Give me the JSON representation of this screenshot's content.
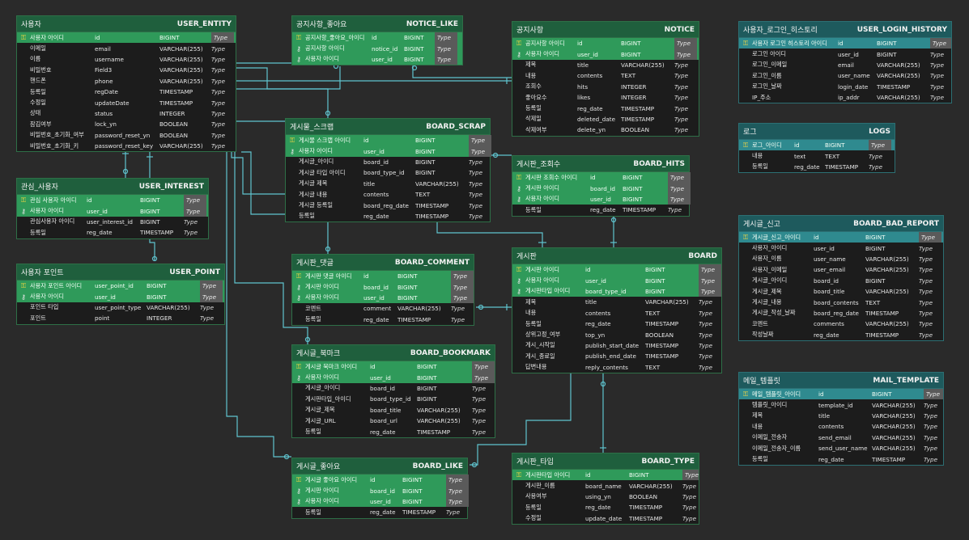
{
  "colors": {
    "background": "#2a2a2a",
    "header_green": "#1f5f3d",
    "header_teal": "#1e5a5d",
    "key_row_green": "#2f9a5a",
    "key_row_teal": "#2f8a8f",
    "connector": "#5fc4cf"
  },
  "entities": [
    {
      "id": "user_entity",
      "theme": "green",
      "name_ko": "사용자",
      "name_en": "USER_ENTITY",
      "rows": [
        {
          "k": "pk",
          "ko": "사용자 아이디",
          "col": "id",
          "type": "BIGINT",
          "ty": "Type"
        },
        {
          "k": "",
          "ko": "이메일",
          "col": "email",
          "type": "VARCHAR(255)",
          "ty": "Type"
        },
        {
          "k": "",
          "ko": "이름",
          "col": "username",
          "type": "VARCHAR(255)",
          "ty": "Type"
        },
        {
          "k": "",
          "ko": "비밀번호",
          "col": "Field3",
          "type": "VARCHAR(255)",
          "ty": "Type"
        },
        {
          "k": "",
          "ko": "핸드폰",
          "col": "phone",
          "type": "VARCHAR(255)",
          "ty": "Type"
        },
        {
          "k": "",
          "ko": "등록일",
          "col": "regDate",
          "type": "TIMESTAMP",
          "ty": "Type"
        },
        {
          "k": "",
          "ko": "수정일",
          "col": "updateDate",
          "type": "TIMESTAMP",
          "ty": "Type"
        },
        {
          "k": "",
          "ko": "상태",
          "col": "status",
          "type": "INTEGER",
          "ty": "Type"
        },
        {
          "k": "",
          "ko": "잠김여부",
          "col": "lock_yn",
          "type": "BOOLEAN",
          "ty": "Type"
        },
        {
          "k": "",
          "ko": "비밀번호_초기화_여부",
          "col": "password_reset_yn",
          "type": "BOOLEAN",
          "ty": "Type"
        },
        {
          "k": "",
          "ko": "비밀번호_초기화_키",
          "col": "password_reset_key",
          "type": "VARCHAR(255)",
          "ty": "Type"
        }
      ]
    },
    {
      "id": "user_interest",
      "theme": "green",
      "name_ko": "관심_사용자",
      "name_en": "USER_INTEREST",
      "rows": [
        {
          "k": "pk",
          "ko": "관심 사용자 아이디",
          "col": "id",
          "type": "BIGINT",
          "ty": "Type"
        },
        {
          "k": "fk",
          "ko": "사용자 아이디",
          "col": "user_id",
          "type": "BIGINT",
          "ty": "Type"
        },
        {
          "k": "",
          "ko": "관심사용자 아이디",
          "col": "user_interest_id",
          "type": "BIGINT",
          "ty": "Type"
        },
        {
          "k": "",
          "ko": "등록일",
          "col": "reg_date",
          "type": "TIMESTAMP",
          "ty": "Type"
        }
      ]
    },
    {
      "id": "user_point",
      "theme": "green",
      "name_ko": "사용자 포인트",
      "name_en": "USER_POINT",
      "rows": [
        {
          "k": "pk",
          "ko": "사용자 포인트 아이디",
          "col": "user_point_id",
          "type": "BIGINT",
          "ty": "Type"
        },
        {
          "k": "fk",
          "ko": "사용자 아이디",
          "col": "user_id",
          "type": "BIGINT",
          "ty": "Type"
        },
        {
          "k": "",
          "ko": "포인트 타입",
          "col": "user_point_type",
          "type": "VARCHAR(255)",
          "ty": "Type"
        },
        {
          "k": "",
          "ko": "포인트",
          "col": "point",
          "type": "INTEGER",
          "ty": "Type"
        }
      ]
    },
    {
      "id": "notice_like",
      "theme": "green",
      "name_ko": "공지사항_좋아요",
      "name_en": "NOTICE_LIKE",
      "rows": [
        {
          "k": "pk",
          "ko": "공지사항_좋아요_아이디",
          "col": "id",
          "type": "BIGINT",
          "ty": "Type"
        },
        {
          "k": "fk",
          "ko": "공지사항 아이디",
          "col": "notice_id",
          "type": "BIGINT",
          "ty": "Type"
        },
        {
          "k": "fk",
          "ko": "사용자 아이디",
          "col": "user_id",
          "type": "BIGINT",
          "ty": "Type"
        }
      ]
    },
    {
      "id": "board_scrap",
      "theme": "green",
      "name_ko": "게시물_스크랩",
      "name_en": "BOARD_SCRAP",
      "rows": [
        {
          "k": "pk",
          "ko": "게시물 스크랩 아이디",
          "col": "id",
          "type": "BIGINT",
          "ty": "Type"
        },
        {
          "k": "fk",
          "ko": "사용자 아이디",
          "col": "user_id",
          "type": "BIGINT",
          "ty": "Type"
        },
        {
          "k": "",
          "ko": "게시글_아이디",
          "col": "board_id",
          "type": "BIGINT",
          "ty": "Type"
        },
        {
          "k": "",
          "ko": "게시글 타입 아이디",
          "col": "board_type_id",
          "type": "BIGINT",
          "ty": "Type"
        },
        {
          "k": "",
          "ko": "게시글 제목",
          "col": "title",
          "type": "VARCHAR(255)",
          "ty": "Type"
        },
        {
          "k": "",
          "ko": "게시글 내용",
          "col": "contents",
          "type": "TEXT",
          "ty": "Type"
        },
        {
          "k": "",
          "ko": "게시글 등록일",
          "col": "board_reg_date",
          "type": "TIMESTAMP",
          "ty": "Type"
        },
        {
          "k": "",
          "ko": "등록일",
          "col": "reg_date",
          "type": "TIMESTAMP",
          "ty": "Type"
        }
      ]
    },
    {
      "id": "board_comment",
      "theme": "green",
      "name_ko": "게시판_댓글",
      "name_en": "BOARD_COMMENT",
      "rows": [
        {
          "k": "pk",
          "ko": "게시판 댓글 아이디",
          "col": "id",
          "type": "BIGINT",
          "ty": "Type"
        },
        {
          "k": "fk",
          "ko": "게시판 아이디",
          "col": "board_id",
          "type": "BIGINT",
          "ty": "Type"
        },
        {
          "k": "fk",
          "ko": "사용자 아이디",
          "col": "user_id",
          "type": "BIGINT",
          "ty": "Type"
        },
        {
          "k": "",
          "ko": "코멘트",
          "col": "comment",
          "type": "VARCHAR(255)",
          "ty": "Type"
        },
        {
          "k": "",
          "ko": "등록일",
          "col": "reg_date",
          "type": "TIMESTAMP",
          "ty": "Type"
        }
      ]
    },
    {
      "id": "board_bookmark",
      "theme": "green",
      "name_ko": "게시글_북마크",
      "name_en": "BOARD_BOOKMARK",
      "rows": [
        {
          "k": "pk",
          "ko": "게시글 북마크 아이디",
          "col": "id",
          "type": "BIGINT",
          "ty": "Type"
        },
        {
          "k": "fk",
          "ko": "사용자 아이디",
          "col": "user_id",
          "type": "BIGINT",
          "ty": "Type"
        },
        {
          "k": "",
          "ko": "게시글_아이디",
          "col": "board_id",
          "type": "BIGINT",
          "ty": "Type"
        },
        {
          "k": "",
          "ko": "게시판타입_아이디",
          "col": "board_type_id",
          "type": "BIGINT",
          "ty": "Type"
        },
        {
          "k": "",
          "ko": "게시글_제목",
          "col": "board_title",
          "type": "VARCHAR(255)",
          "ty": "Type"
        },
        {
          "k": "",
          "ko": "게시글_URL",
          "col": "board_url",
          "type": "VARCHAR(255)",
          "ty": "Type"
        },
        {
          "k": "",
          "ko": "등록일",
          "col": "reg_date",
          "type": "TIMESTAMP",
          "ty": "Type"
        }
      ]
    },
    {
      "id": "board_like",
      "theme": "green",
      "name_ko": "게시글_좋아요",
      "name_en": "BOARD_LIKE",
      "rows": [
        {
          "k": "pk",
          "ko": "게시글 좋아요 아이디",
          "col": "id",
          "type": "BIGINT",
          "ty": "Type"
        },
        {
          "k": "fk",
          "ko": "게시판 아이디",
          "col": "board_id",
          "type": "BIGINT",
          "ty": "Type"
        },
        {
          "k": "fk",
          "ko": "사용자 아이디",
          "col": "user_id",
          "type": "BIGINT",
          "ty": "Type"
        },
        {
          "k": "",
          "ko": "등록일",
          "col": "reg_date",
          "type": "TIMESTAMP",
          "ty": "Type"
        }
      ]
    },
    {
      "id": "notice",
      "theme": "green",
      "name_ko": "공지사항",
      "name_en": "NOTICE",
      "rows": [
        {
          "k": "pk",
          "ko": "공지사항 아이디",
          "col": "id",
          "type": "BIGINT",
          "ty": "Type"
        },
        {
          "k": "fk",
          "ko": "사용자 아이디",
          "col": "user_id",
          "type": "BIGINT",
          "ty": "Type"
        },
        {
          "k": "",
          "ko": "제목",
          "col": "title",
          "type": "VARCHAR(255)",
          "ty": "Type"
        },
        {
          "k": "",
          "ko": "내용",
          "col": "contents",
          "type": "TEXT",
          "ty": "Type"
        },
        {
          "k": "",
          "ko": "조회수",
          "col": "hits",
          "type": "INTEGER",
          "ty": "Type"
        },
        {
          "k": "",
          "ko": "좋아요수",
          "col": "likes",
          "type": "INTEGER",
          "ty": "Type"
        },
        {
          "k": "",
          "ko": "등록일",
          "col": "reg_date",
          "type": "TIMESTAMP",
          "ty": "Type"
        },
        {
          "k": "",
          "ko": "삭제일",
          "col": "deleted_date",
          "type": "TIMESTAMP",
          "ty": "Type"
        },
        {
          "k": "",
          "ko": "삭제여부",
          "col": "delete_yn",
          "type": "BOOLEAN",
          "ty": "Type"
        }
      ]
    },
    {
      "id": "board_hits",
      "theme": "green",
      "name_ko": "게시판_조회수",
      "name_en": "BOARD_HITS",
      "rows": [
        {
          "k": "pk",
          "ko": "게시판 조회수 아이디",
          "col": "id",
          "type": "BIGINT",
          "ty": "Type"
        },
        {
          "k": "fk",
          "ko": "게시판 아이디",
          "col": "board_id",
          "type": "BIGINT",
          "ty": "Type"
        },
        {
          "k": "fk",
          "ko": "사용자 아이디",
          "col": "user_id",
          "type": "BIGINT",
          "ty": "Type"
        },
        {
          "k": "",
          "ko": "등록일",
          "col": "reg_date",
          "type": "TIMESTAMP",
          "ty": "Type"
        }
      ]
    },
    {
      "id": "board",
      "theme": "green",
      "name_ko": "게시판",
      "name_en": "BOARD",
      "rows": [
        {
          "k": "pk",
          "ko": "게시판 아이디",
          "col": "id",
          "type": "BIGINT",
          "ty": "Type"
        },
        {
          "k": "fk",
          "ko": "사용자 아이디",
          "col": "user_id",
          "type": "BIGINT",
          "ty": "Type"
        },
        {
          "k": "fk",
          "ko": "게시판타입 아이디",
          "col": "board_type_id",
          "type": "BIGINT",
          "ty": "Type"
        },
        {
          "k": "",
          "ko": "제목",
          "col": "title",
          "type": "VARCHAR(255)",
          "ty": "Type"
        },
        {
          "k": "",
          "ko": "내용",
          "col": "contents",
          "type": "TEXT",
          "ty": "Type"
        },
        {
          "k": "",
          "ko": "등록일",
          "col": "reg_date",
          "type": "TIMESTAMP",
          "ty": "Type"
        },
        {
          "k": "",
          "ko": "상위고정_여부",
          "col": "top_yn",
          "type": "BOOLEAN",
          "ty": "Type"
        },
        {
          "k": "",
          "ko": "게시_시작일",
          "col": "publish_start_date",
          "type": "TIMESTAMP",
          "ty": "Type"
        },
        {
          "k": "",
          "ko": "게시_종료일",
          "col": "publish_end_date",
          "type": "TIMESTAMP",
          "ty": "Type"
        },
        {
          "k": "",
          "ko": "답변내용",
          "col": "reply_contents",
          "type": "TEXT",
          "ty": "Type"
        }
      ]
    },
    {
      "id": "board_type",
      "theme": "green",
      "name_ko": "게시판_타입",
      "name_en": "BOARD_TYPE",
      "rows": [
        {
          "k": "pk",
          "ko": "게시판타입 아이디",
          "col": "id",
          "type": "BIGINT",
          "ty": "Type"
        },
        {
          "k": "",
          "ko": "게시판_이름",
          "col": "board_name",
          "type": "VARCHAR(255)",
          "ty": "Type"
        },
        {
          "k": "",
          "ko": "사용여부",
          "col": "using_yn",
          "type": "BOOLEAN",
          "ty": "Type"
        },
        {
          "k": "",
          "ko": "등록일",
          "col": "reg_date",
          "type": "TIMESTAMP",
          "ty": "Type"
        },
        {
          "k": "",
          "ko": "수정일",
          "col": "update_date",
          "type": "TIMESTAMP",
          "ty": "Type"
        }
      ]
    },
    {
      "id": "user_login_history",
      "theme": "blue",
      "name_ko": "사용자_로그인_히스토리",
      "name_en": "USER_LOGIN_HISTORY",
      "rows": [
        {
          "k": "pk",
          "ko": "사용자 로그인 히스토리 아이디",
          "col": "id",
          "type": "BIGINT",
          "ty": "Type"
        },
        {
          "k": "",
          "ko": "로그인 아이디",
          "col": "user_id",
          "type": "BIGINT",
          "ty": "Type"
        },
        {
          "k": "",
          "ko": "로그인_이메일",
          "col": "email",
          "type": "VARCHAR(255)",
          "ty": "Type"
        },
        {
          "k": "",
          "ko": "로그인_이름",
          "col": "user_name",
          "type": "VARCHAR(255)",
          "ty": "Type"
        },
        {
          "k": "",
          "ko": "로그인_날짜",
          "col": "login_date",
          "type": "TIMESTAMP",
          "ty": "Type"
        },
        {
          "k": "",
          "ko": "IP_주소",
          "col": "ip_addr",
          "type": "VARCHAR(255)",
          "ty": "Type"
        }
      ]
    },
    {
      "id": "logs",
      "theme": "blue",
      "name_ko": "로그",
      "name_en": "LOGS",
      "rows": [
        {
          "k": "pk",
          "ko": "로그_아이디",
          "col": "id",
          "type": "BIGINT",
          "ty": "Type"
        },
        {
          "k": "",
          "ko": "내용",
          "col": "text",
          "type": "TEXT",
          "ty": "Type"
        },
        {
          "k": "",
          "ko": "등록일",
          "col": "reg_date",
          "type": "TIMESTAMP",
          "ty": "Type"
        }
      ]
    },
    {
      "id": "board_bad_report",
      "theme": "blue",
      "name_ko": "게시글_신고",
      "name_en": "BOARD_BAD_REPORT",
      "rows": [
        {
          "k": "pk",
          "ko": "게시글_신고_아이디",
          "col": "id",
          "type": "BIGINT",
          "ty": "Type"
        },
        {
          "k": "",
          "ko": "사용자_아이디",
          "col": "user_id",
          "type": "BIGINT",
          "ty": "Type"
        },
        {
          "k": "",
          "ko": "사용자_이름",
          "col": "user_name",
          "type": "VARCHAR(255)",
          "ty": "Type"
        },
        {
          "k": "",
          "ko": "사용자_이메일",
          "col": "user_email",
          "type": "VARCHAR(255)",
          "ty": "Type"
        },
        {
          "k": "",
          "ko": "게시글_아이디",
          "col": "board_id",
          "type": "BIGINT",
          "ty": "Type"
        },
        {
          "k": "",
          "ko": "게시글_제목",
          "col": "board_title",
          "type": "VARCHAR(255)",
          "ty": "Type"
        },
        {
          "k": "",
          "ko": "게시글_내용",
          "col": "board_contents",
          "type": "TEXT",
          "ty": "Type"
        },
        {
          "k": "",
          "ko": "게시글_작성_날짜",
          "col": "board_reg_date",
          "type": "TIMESTAMP",
          "ty": "Type"
        },
        {
          "k": "",
          "ko": "코멘트",
          "col": "comments",
          "type": "VARCHAR(255)",
          "ty": "Type"
        },
        {
          "k": "",
          "ko": "작성날짜",
          "col": "reg_date",
          "type": "TIMESTAMP",
          "ty": "Type"
        }
      ]
    },
    {
      "id": "mail_template",
      "theme": "blue",
      "name_ko": "메일_템플릿",
      "name_en": "MAIL_TEMPLATE",
      "rows": [
        {
          "k": "pk",
          "ko": "메일_템플릿_아이디",
          "col": "id",
          "type": "BIGINT",
          "ty": "Type"
        },
        {
          "k": "",
          "ko": "템플릿_아이디",
          "col": "template_id",
          "type": "VARCHAR(255)",
          "ty": "Type"
        },
        {
          "k": "",
          "ko": "제목",
          "col": "title",
          "type": "VARCHAR(255)",
          "ty": "Type"
        },
        {
          "k": "",
          "ko": "내용",
          "col": "contents",
          "type": "VARCHAR(255)",
          "ty": "Type"
        },
        {
          "k": "",
          "ko": "이메일_전송자",
          "col": "send_email",
          "type": "VARCHAR(255)",
          "ty": "Type"
        },
        {
          "k": "",
          "ko": "이메일_전송자_이름",
          "col": "send_user_name",
          "type": "VARCHAR(255)",
          "ty": "Type"
        },
        {
          "k": "",
          "ko": "등록일",
          "col": "reg_date",
          "type": "TIMESTAMP",
          "ty": "Type"
        }
      ]
    }
  ]
}
